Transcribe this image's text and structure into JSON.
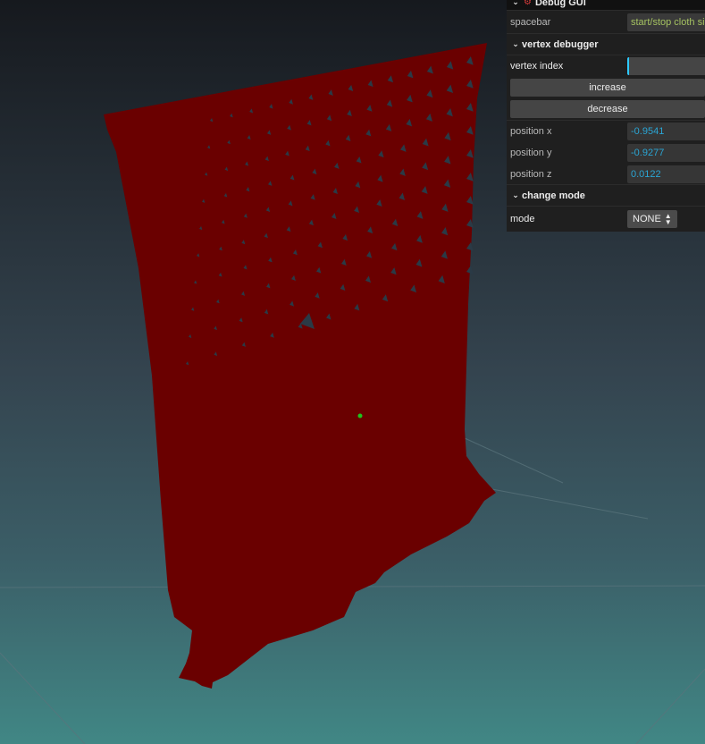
{
  "gui": {
    "title": "Debug GUI",
    "spacebar_label": "spacebar",
    "spacebar_value": "start/stop cloth sim",
    "folders": {
      "vertex_debugger": "vertex debugger",
      "change_mode": "change mode"
    },
    "vertex_index_label": "vertex index",
    "vertex_index_value": "",
    "increase_label": "increase",
    "decrease_label": "decrease",
    "position_x_label": "position x",
    "position_x_value": "-0.9541",
    "position_y_label": "position y",
    "position_y_value": "-0.9277",
    "position_z_label": "position z",
    "position_z_value": "0.0122",
    "mode_label": "mode",
    "mode_value": "NONE"
  },
  "colors": {
    "cloth": "#6a0000",
    "vertex_marker": "#1ec41e",
    "grid_line": "#556a72"
  },
  "icons": {
    "title": "bug-icon",
    "folder": "chevron-down-icon",
    "select": "updown-arrows-icon"
  }
}
